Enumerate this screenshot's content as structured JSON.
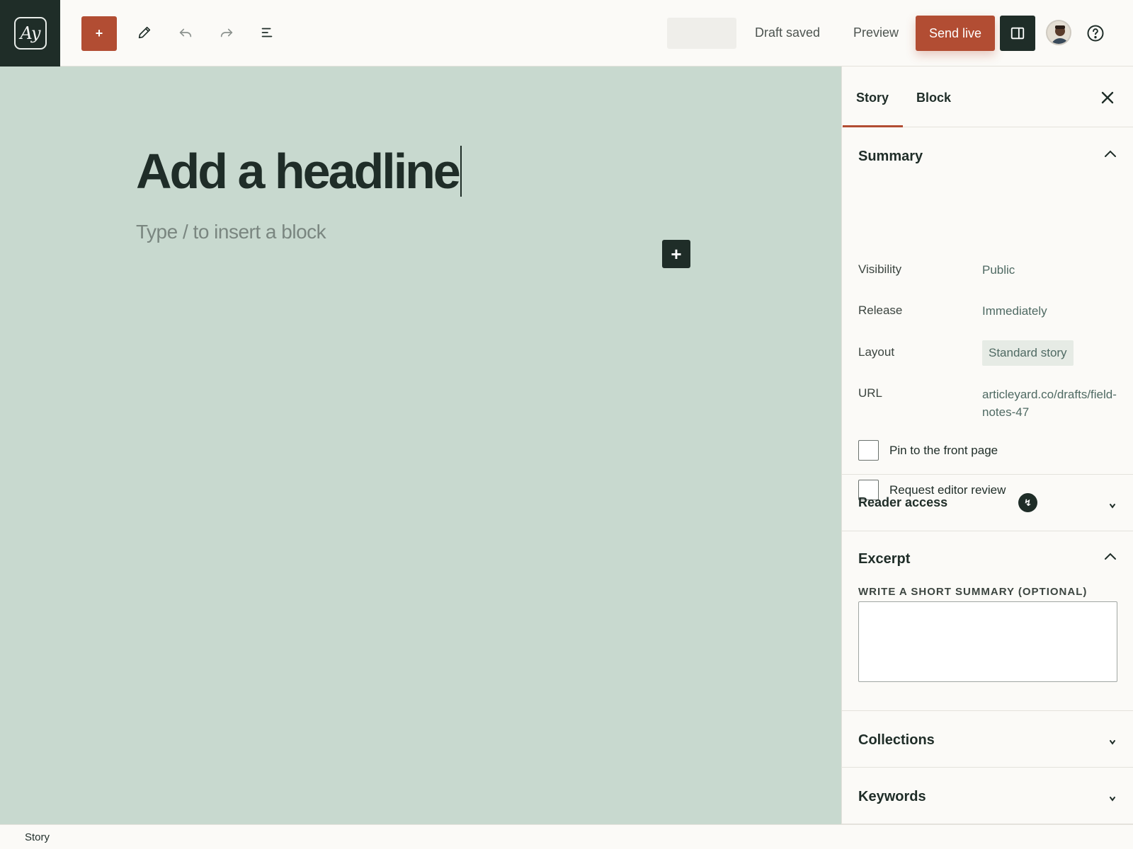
{
  "app": {
    "logo_text": "Ay"
  },
  "toolbar": {
    "add_label": "+",
    "draft_status": "Draft saved",
    "preview_label": "Preview",
    "send_live_label": "Send live",
    "icons": [
      "pencil-icon",
      "undo-icon",
      "redo-icon",
      "list-view-icon",
      "sidebar-toggle-icon",
      "help-icon"
    ],
    "colors": {
      "accent": "#b24d33",
      "dark": "#1f2d28"
    }
  },
  "editor": {
    "headline_placeholder": "Add a headline",
    "block_placeholder": "Type / to insert a block",
    "inline_add_label": "+",
    "canvas_color": "#c8d9cf"
  },
  "sidebar": {
    "tabs": [
      {
        "label": "Story",
        "active": true
      },
      {
        "label": "Block",
        "active": false
      }
    ],
    "summary": {
      "title": "Summary",
      "rows": [
        {
          "label": "Visibility",
          "value": "Public"
        },
        {
          "label": "Release",
          "value": "Immediately"
        },
        {
          "label": "Layout",
          "value": "Standard story"
        },
        {
          "label": "URL",
          "value": "articleyard.co/drafts/field-notes-47"
        }
      ],
      "checkboxes": [
        {
          "label": "Pin to the front page",
          "checked": false
        },
        {
          "label": "Request editor review",
          "checked": false
        }
      ]
    },
    "reader_access": {
      "title": "Reader access",
      "badge": "↯"
    },
    "excerpt": {
      "title": "Excerpt",
      "field_label": "WRITE A SHORT SUMMARY (OPTIONAL)",
      "value": ""
    },
    "collections": {
      "title": "Collections"
    },
    "keywords": {
      "title": "Keywords"
    }
  },
  "statusbar": {
    "breadcrumb": "Story"
  }
}
